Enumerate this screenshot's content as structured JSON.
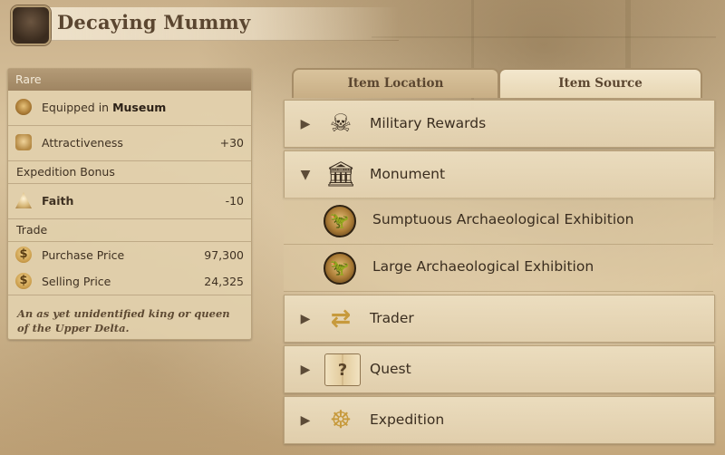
{
  "header": {
    "title": "Decaying Mummy",
    "portrait_icon": "mummy-portrait-icon"
  },
  "item_panel": {
    "rarity": "Rare",
    "equipped_prefix": "Equipped in",
    "equipped_location": "Museum",
    "stats": [
      {
        "label": "Attractiveness",
        "value": "+30",
        "icon": "lyre-icon"
      }
    ],
    "expedition_section": "Expedition Bonus",
    "expedition_bonus": [
      {
        "label": "Faith",
        "value": "-10",
        "icon": "faith-icon"
      }
    ],
    "trade_section": "Trade",
    "trade": [
      {
        "label": "Purchase Price",
        "value": "97,300",
        "icon": "coin-icon",
        "glyph": "$"
      },
      {
        "label": "Selling Price",
        "value": "24,325",
        "icon": "coin-icon",
        "glyph": "$"
      }
    ],
    "description": "An as yet unidentified king or queen of the Upper Delta."
  },
  "tabs": [
    {
      "label": "Item Location",
      "selected": false
    },
    {
      "label": "Item Source",
      "selected": true
    }
  ],
  "sources": [
    {
      "label": "Military Rewards",
      "icon": "skull-crossbones-icon",
      "glyph": "☠",
      "expanded": false
    },
    {
      "label": "Monument",
      "icon": "temple-icon",
      "glyph": "🏛",
      "expanded": true,
      "children": [
        {
          "label": "Sumptuous Archaeological Exhibition",
          "icon": "dinosaur-medal-icon"
        },
        {
          "label": "Large Archaeological Exhibition",
          "icon": "dinosaur-medal-icon"
        }
      ]
    },
    {
      "label": "Trader",
      "icon": "trade-arrows-icon",
      "glyph": "⇄",
      "expanded": false
    },
    {
      "label": "Quest",
      "icon": "quest-book-icon",
      "glyph": "?",
      "expanded": false
    },
    {
      "label": "Expedition",
      "icon": "ship-wheel-icon",
      "glyph": "☸",
      "expanded": false
    }
  ],
  "arrows": {
    "collapsed": "▶",
    "expanded": "▼"
  },
  "colors": {
    "panel": "#e2d0ac",
    "text": "#3a2d1f",
    "title": "#5b4630",
    "tab_active": "#f3e7cd"
  }
}
